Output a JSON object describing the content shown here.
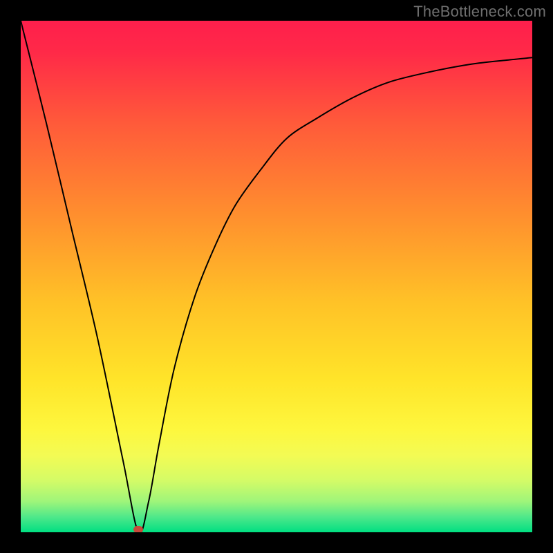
{
  "attribution": "TheBottleneck.com",
  "colors": {
    "frame": "#000000",
    "gradient_stops": [
      {
        "offset": 0.0,
        "color": "#ff1f4c"
      },
      {
        "offset": 0.06,
        "color": "#ff2948"
      },
      {
        "offset": 0.2,
        "color": "#ff5a3a"
      },
      {
        "offset": 0.38,
        "color": "#ff8f2e"
      },
      {
        "offset": 0.55,
        "color": "#ffc227"
      },
      {
        "offset": 0.7,
        "color": "#ffe429"
      },
      {
        "offset": 0.8,
        "color": "#fdf73e"
      },
      {
        "offset": 0.85,
        "color": "#f3fb54"
      },
      {
        "offset": 0.9,
        "color": "#d3fb67"
      },
      {
        "offset": 0.94,
        "color": "#9ef57a"
      },
      {
        "offset": 0.97,
        "color": "#4fe88a"
      },
      {
        "offset": 1.0,
        "color": "#00df82"
      }
    ],
    "curve": "#000000",
    "marker": "#c94a3b"
  },
  "chart_data": {
    "type": "line",
    "title": "",
    "xlabel": "",
    "ylabel": "",
    "xlim": [
      0,
      100
    ],
    "ylim": [
      0,
      100
    ],
    "grid": false,
    "minimum_point": {
      "x": 23,
      "y": 0
    },
    "series": [
      {
        "name": "bottleneck-curve",
        "x": [
          0,
          5,
          10,
          15,
          20,
          23,
          25,
          27,
          30,
          34,
          38,
          42,
          47,
          52,
          58,
          65,
          72,
          80,
          88,
          95,
          100
        ],
        "y": [
          100,
          80,
          59,
          38,
          14,
          0,
          6,
          17,
          32,
          46,
          56,
          64,
          71,
          77,
          81,
          85,
          88,
          90,
          91.5,
          92.3,
          92.8
        ]
      }
    ],
    "markers": [
      {
        "name": "minimum-marker",
        "x": 23,
        "y": 0.5
      }
    ]
  }
}
